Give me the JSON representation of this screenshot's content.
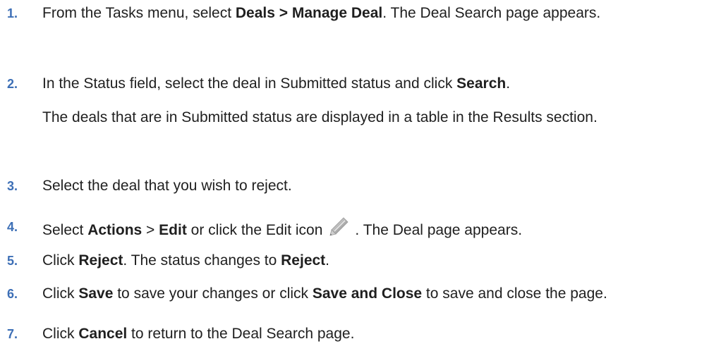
{
  "steps": [
    {
      "number": "1.",
      "parts": [
        "From the Tasks menu, select ",
        "Deals > Manage Deal",
        ". The Deal Search page appears."
      ]
    },
    {
      "number": "2.",
      "parts": [
        "In the Status field, select the deal in Submitted status and click ",
        "Search",
        "."
      ],
      "note": "The deals that are in Submitted status are displayed in a table in the Results section."
    },
    {
      "number": "3.",
      "parts": [
        "Select the deal that you wish to reject."
      ]
    },
    {
      "number": "4.",
      "parts": [
        "Select ",
        "Actions",
        " > ",
        "Edit",
        " or click the Edit icon",
        ". The Deal page appears."
      ],
      "icon": "pencil-edit-icon"
    },
    {
      "number": "5.",
      "parts": [
        "Click ",
        "Reject",
        ". The status changes to ",
        "Reject",
        "."
      ]
    },
    {
      "number": "6.",
      "parts": [
        "Click ",
        "Save",
        " to save your changes or click ",
        "Save and Close",
        " to save and close the page."
      ]
    },
    {
      "number": "7.",
      "parts": [
        "Click ",
        "Cancel",
        " to return to the Deal Search page."
      ]
    }
  ],
  "colors": {
    "step_number": "#3d6fb6",
    "text": "#1f1f1f"
  }
}
